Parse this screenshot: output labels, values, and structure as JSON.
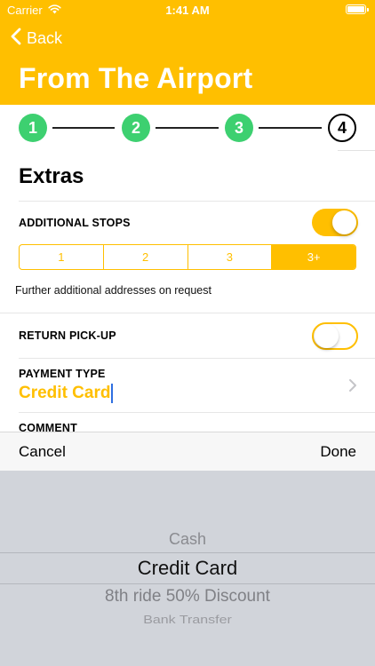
{
  "status_bar": {
    "carrier": "Carrier",
    "time": "1:41 AM"
  },
  "nav": {
    "back_label": "Back",
    "title": "From The Airport"
  },
  "stepper": {
    "steps": [
      "1",
      "2",
      "3",
      "4"
    ],
    "current_step": 4
  },
  "extras": {
    "title": "Extras",
    "additional_stops": {
      "label": "ADDITIONAL STOPS",
      "enabled": true,
      "options": [
        "1",
        "2",
        "3",
        "3+"
      ],
      "selected": "3+",
      "note": "Further additional addresses on request"
    },
    "return_pickup": {
      "label": "RETURN PICK-UP",
      "enabled": false
    },
    "payment": {
      "label": "PAYMENT TYPE",
      "value": "Credit Card"
    },
    "comment": {
      "label": "COMMENT"
    }
  },
  "picker": {
    "cancel_label": "Cancel",
    "done_label": "Done",
    "options": [
      "Cash",
      "Credit Card",
      "8th ride 50% Discount",
      "Bank Transfer"
    ],
    "selected": "Credit Card"
  },
  "colors": {
    "accent": "#FFBF00",
    "step_done": "#3DD070",
    "picker_bg": "#D1D4DA"
  }
}
